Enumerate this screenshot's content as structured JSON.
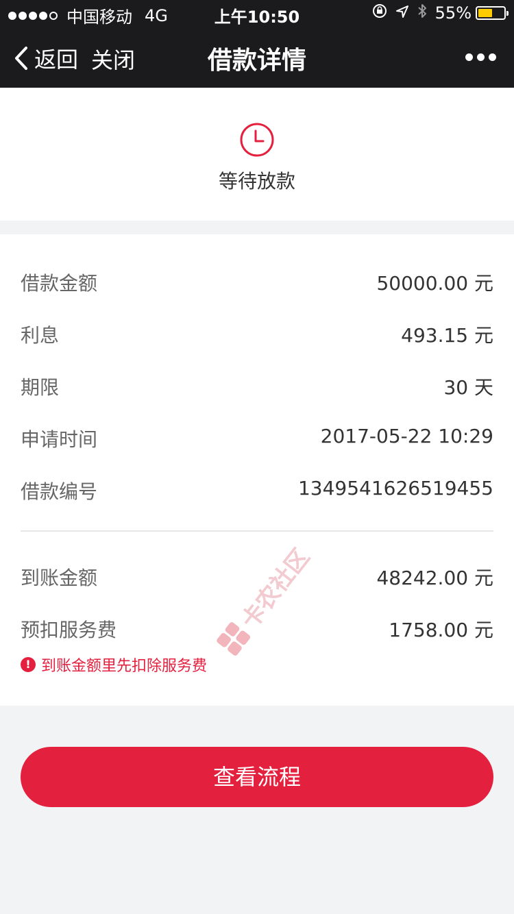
{
  "statusbar": {
    "carrier": "中国移动",
    "network": "4G",
    "time": "上午10:50",
    "battery": "55%",
    "battery_level": 0.55
  },
  "nav": {
    "back": "返回",
    "close": "关闭",
    "title": "借款详情"
  },
  "status": {
    "text": "等待放款"
  },
  "details": [
    {
      "label": "借款金额",
      "value": "50000.00 元"
    },
    {
      "label": "利息",
      "value": "493.15  元"
    },
    {
      "label": "期限",
      "value": "30 天"
    },
    {
      "label": "申请时间",
      "value": "2017-05-22 10:29"
    },
    {
      "label": "借款编号",
      "value": "1349541626519455"
    }
  ],
  "amounts": [
    {
      "label": "到账金额",
      "value": "48242.00 元"
    },
    {
      "label": "预扣服务费",
      "value": "1758.00  元"
    }
  ],
  "warning": {
    "icon": "!",
    "text": "到账金额里先扣除服务费"
  },
  "watermark": "卡农社区",
  "action": {
    "label": "查看流程"
  },
  "colors": {
    "accent": "#e4203f",
    "navbar": "#1b1b1d"
  }
}
